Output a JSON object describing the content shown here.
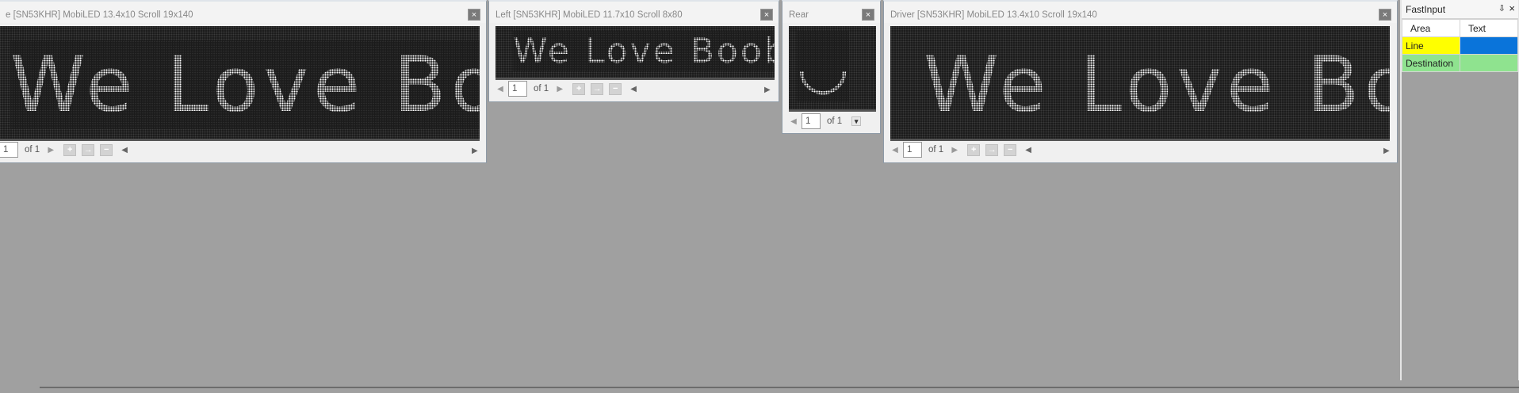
{
  "windows": {
    "front": {
      "title": "e [SN53KHR] MobiLED 13.4x10 Scroll 19x140",
      "display_text": "We Love Boobies",
      "page": "1",
      "of_label": "of 1"
    },
    "left": {
      "title": "Left [SN53KHR] MobiLED 11.7x10 Scroll 8x80",
      "display_text": "We Love Boobies",
      "page": "1",
      "of_label": "of 1"
    },
    "rear": {
      "title": "Rear",
      "display_text": "◡",
      "page": "1",
      "of_label": "of 1"
    },
    "driver": {
      "title": "Driver [SN53KHR] MobiLED 13.4x10 Scroll 19x140",
      "display_text": "We Love Boobies",
      "page": "1",
      "of_label": "of 1"
    }
  },
  "icons": {
    "close": "×",
    "prev": "◀",
    "next": "▶",
    "add": "+",
    "play": "→",
    "remove": "−",
    "scroll_left": "◀",
    "scroll_right": "▶",
    "pin": "📌",
    "dropdown": "▾"
  },
  "fast_input": {
    "title": "FastInput",
    "columns": [
      "Area",
      "Text"
    ],
    "rows": [
      {
        "area": "Line",
        "text": "",
        "area_color": "#ffff00",
        "text_color": "#0a74da"
      },
      {
        "area": "Destination",
        "text": "",
        "area_color": "#8fe38f",
        "text_color": "#8fe38f"
      }
    ]
  }
}
